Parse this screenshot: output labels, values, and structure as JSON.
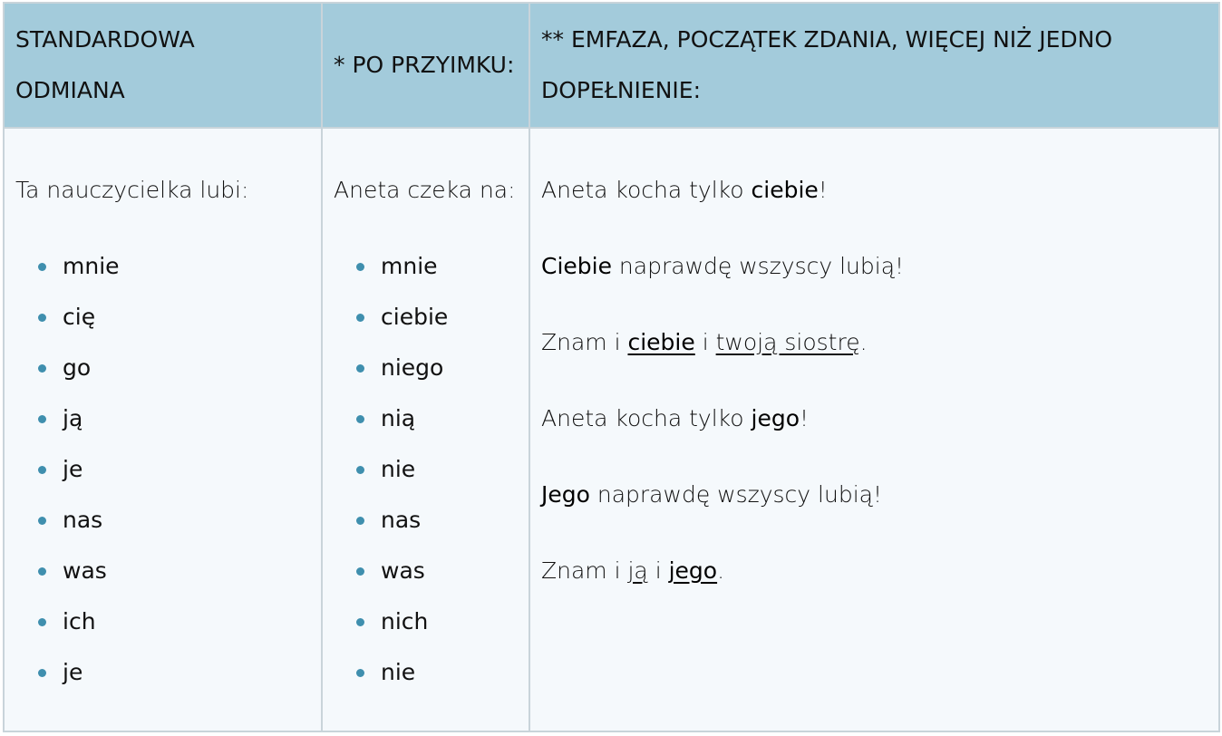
{
  "headers": {
    "col1": "STANDARDOWA ODMIANA",
    "col2": "* PO PRZYIMKU:",
    "col3": "** EMFAZA, POCZĄTEK ZDANIA, WIĘCEJ NIŻ JEDNO DOPEŁNIENIE:"
  },
  "standard": {
    "lead": "Ta nauczycielka lubi:",
    "forms": [
      "mnie",
      "cię",
      "go",
      "ją",
      "je",
      "nas",
      "was",
      "ich",
      "je"
    ]
  },
  "preposition": {
    "lead": "Aneta czeka na:",
    "forms": [
      "mnie",
      "ciebie",
      "niego",
      "nią",
      "nie",
      "nas",
      "was",
      "nich",
      "nie"
    ]
  },
  "emphasis": {
    "s1": {
      "a": "Aneta kocha tylko ",
      "b": "ciebie",
      "c": "!"
    },
    "s2": {
      "a": "Ciebie",
      "b": " naprawdę wszyscy lubią!"
    },
    "s3": {
      "a": "Znam i ",
      "b": "ciebie",
      "c": " i ",
      "d": "twoją siostrę",
      "e": "."
    },
    "s4": {
      "a": "Aneta kocha tylko ",
      "b": "jego",
      "c": "!"
    },
    "s5": {
      "a": "Jego",
      "b": " naprawdę wszyscy lubią!"
    },
    "s6": {
      "a": "Znam i ",
      "b": "ją",
      "c": " i ",
      "d": "jego",
      "e": "."
    }
  },
  "colors": {
    "header_bg": "#a3cbdb",
    "body_bg": "#f5f9fc",
    "bullet": "#3f8fae",
    "border": "#c9d4da"
  }
}
